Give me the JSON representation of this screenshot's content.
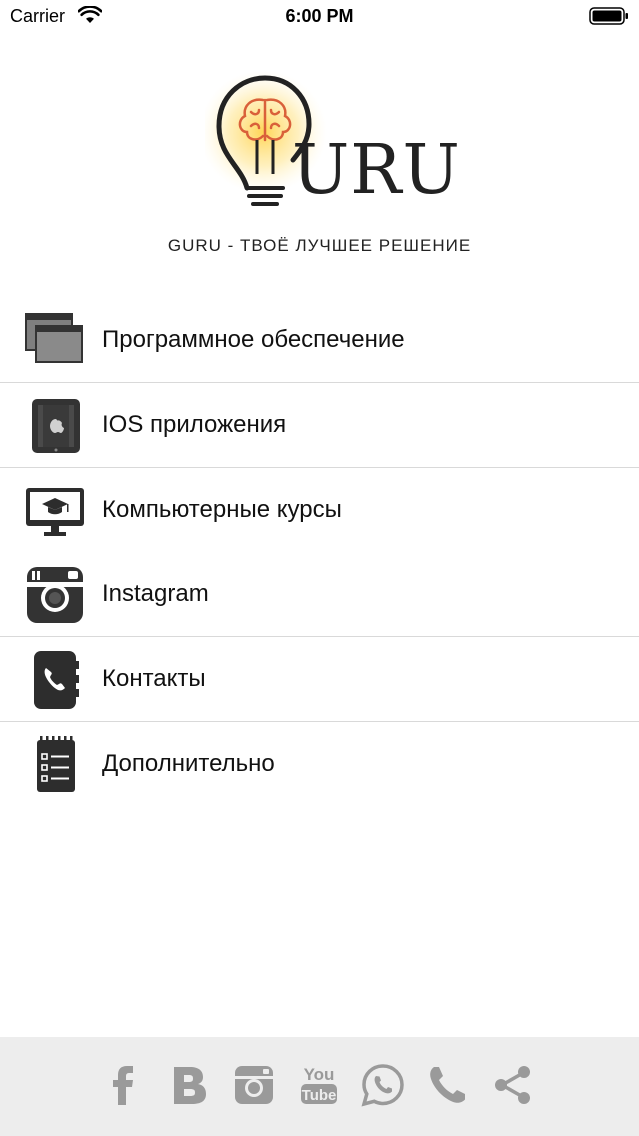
{
  "status_bar": {
    "carrier": "Carrier",
    "time": "6:00 PM",
    "wifi_icon": "wifi-icon",
    "battery_icon": "battery-icon"
  },
  "logo": {
    "text": "URU",
    "tagline": "GURU - ТВОЁ ЛУЧШЕЕ РЕШЕНИЕ"
  },
  "menu": {
    "items": [
      {
        "label": "Программное обеспечение",
        "icon": "windows-icon"
      },
      {
        "label": "IOS приложения",
        "icon": "ipad-icon"
      },
      {
        "label": "Компьютерные курсы",
        "icon": "monitor-graduation-icon"
      },
      {
        "label": "Instagram",
        "icon": "instagram-icon"
      },
      {
        "label": "Контакты",
        "icon": "phone-book-icon"
      },
      {
        "label": "Дополнительно",
        "icon": "notepad-list-icon"
      }
    ]
  },
  "bottom_bar": {
    "icons": [
      "facebook-icon",
      "vk-icon",
      "instagram-icon",
      "youtube-icon",
      "whatsapp-icon",
      "phone-icon",
      "share-icon"
    ],
    "icon_color": "#9a9a9a"
  },
  "colors": {
    "background": "#ffffff",
    "bottom_bar": "#ededed",
    "separator": "#d9d9d9",
    "icon_dark": "#333333",
    "glow": "#ffd34d"
  }
}
